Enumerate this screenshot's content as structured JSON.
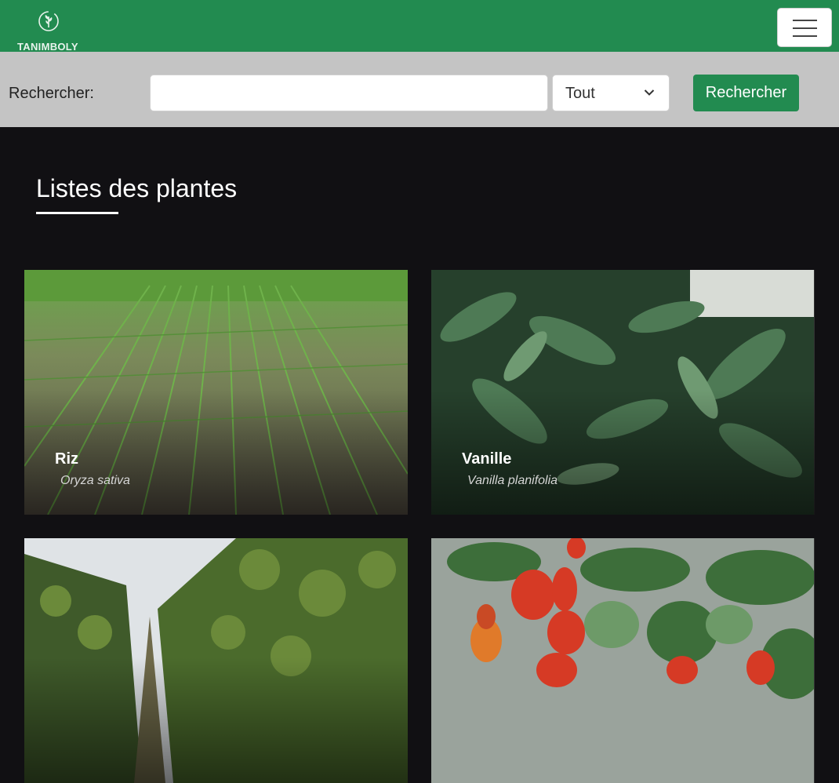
{
  "brand": {
    "name": "TANIMBOLY",
    "icon": "leaf-sprout-icon"
  },
  "navbar": {
    "menu_icon": "hamburger-menu-icon"
  },
  "search": {
    "label": "Rechercher:",
    "input_value": "",
    "placeholder": "",
    "filter_selected": "Tout",
    "button_label": "Rechercher"
  },
  "main": {
    "title": "Listes des plantes"
  },
  "plants": [
    {
      "name": "Riz",
      "scientific": "Oryza sativa"
    },
    {
      "name": "Vanille",
      "scientific": "Vanilla planifolia"
    },
    {
      "name": "",
      "scientific": ""
    },
    {
      "name": "",
      "scientific": ""
    }
  ],
  "colors": {
    "primary": "#228b50",
    "search_bg": "#c4c4c4",
    "page_bg": "#111013"
  }
}
